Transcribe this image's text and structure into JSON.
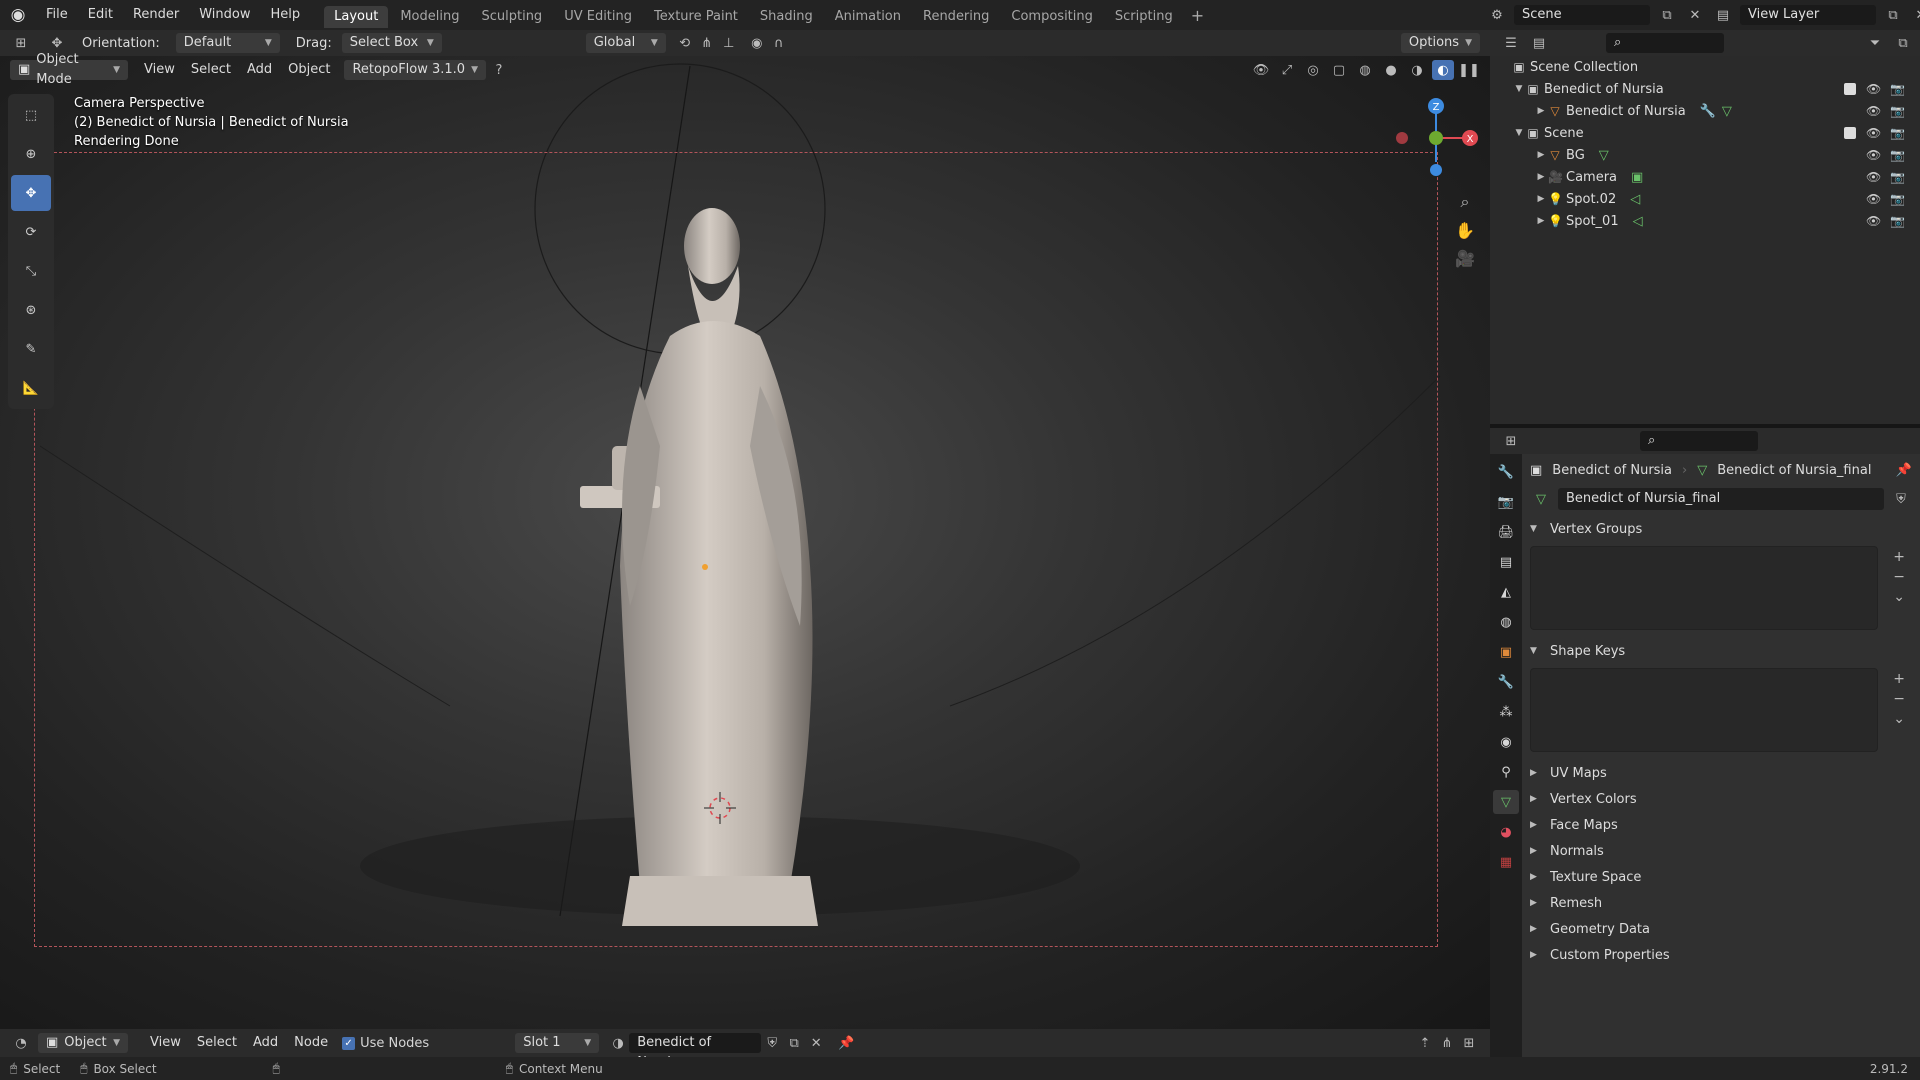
{
  "topbar": {
    "menu": [
      "File",
      "Edit",
      "Render",
      "Window",
      "Help"
    ],
    "workspaces": [
      "Layout",
      "Modeling",
      "Sculpting",
      "UV Editing",
      "Texture Paint",
      "Shading",
      "Animation",
      "Rendering",
      "Compositing",
      "Scripting"
    ],
    "active_workspace": "Layout",
    "scene_name": "Scene",
    "view_layer": "View Layer"
  },
  "header": {
    "orientation_label": "Orientation:",
    "orientation_value": "Default",
    "drag_label": "Drag:",
    "drag_value": "Select Box",
    "transform_orientation": "Global",
    "options_label": "Options"
  },
  "viewport_header": {
    "mode": "Object Mode",
    "menus": [
      "View",
      "Select",
      "Add",
      "Object"
    ],
    "addon": "RetopoFlow 3.1.0"
  },
  "viewport": {
    "line1": "Camera Perspective",
    "line2": "(2) Benedict of Nursia | Benedict of Nursia",
    "line3": "Rendering Done",
    "gizmo_z": "Z",
    "gizmo_x": "X"
  },
  "outliner": {
    "root": "Scene Collection",
    "rows": [
      {
        "name": "Benedict of Nursia",
        "indent": 1
      },
      {
        "name": "Benedict of Nursia",
        "indent": 2
      },
      {
        "name": "Scene",
        "indent": 1
      },
      {
        "name": "BG",
        "indent": 2
      },
      {
        "name": "Camera",
        "indent": 2
      },
      {
        "name": "Spot.02",
        "indent": 2
      },
      {
        "name": "Spot_01",
        "indent": 2
      }
    ]
  },
  "properties": {
    "object_name": "Benedict of Nursia",
    "mesh_name": "Benedict of Nursia_final",
    "datablock": "Benedict of Nursia_final",
    "sections_open": [
      "Vertex Groups",
      "Shape Keys"
    ],
    "sections_closed": [
      "UV Maps",
      "Vertex Colors",
      "Face Maps",
      "Normals",
      "Texture Space",
      "Remesh",
      "Geometry Data",
      "Custom Properties"
    ]
  },
  "bottom_header": {
    "editor_type": "Object",
    "menus": [
      "View",
      "Select",
      "Add",
      "Node"
    ],
    "use_nodes": "Use Nodes",
    "slot": "Slot 1",
    "material": "Benedict of Nursia"
  },
  "statusbar": {
    "select": "Select",
    "box_select": "Box Select",
    "context_menu": "Context Menu",
    "version": "2.91.2"
  },
  "colors": {
    "accent": "#4772b3",
    "camera_frame": "#b3545a",
    "gizmo_x": "#e04a52",
    "gizmo_y": "#6eaa30",
    "gizmo_z": "#3d8be0"
  }
}
